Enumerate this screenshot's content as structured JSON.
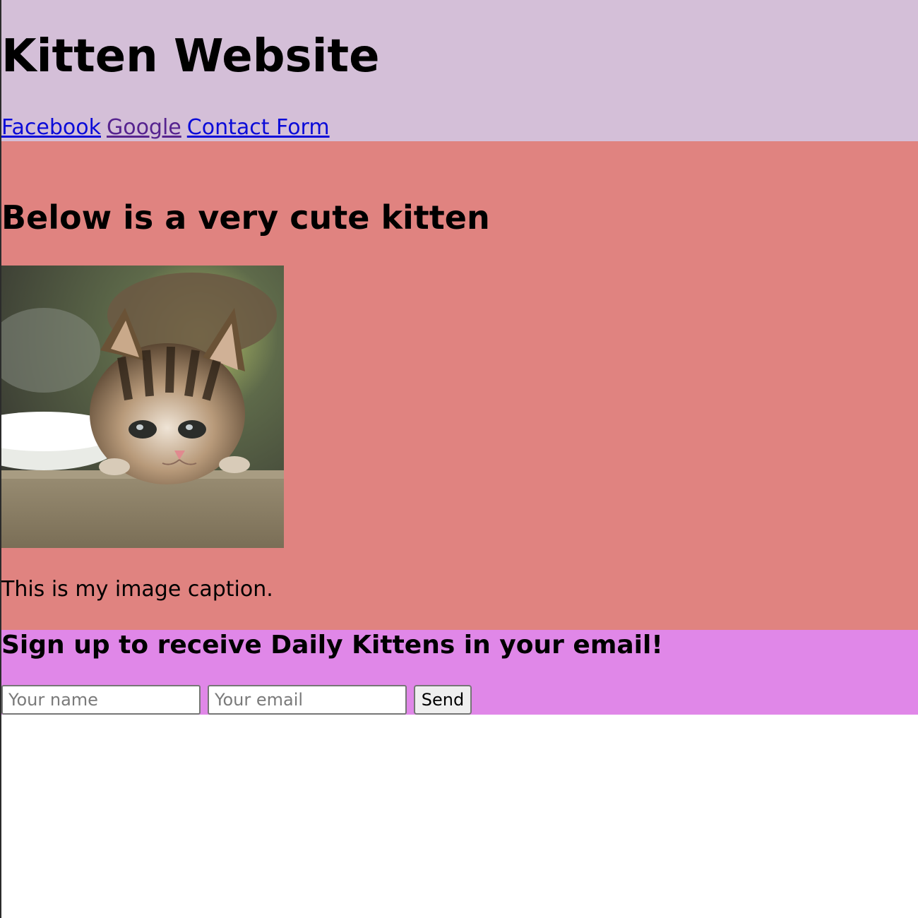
{
  "header": {
    "title": "Kitten Website",
    "nav": [
      {
        "label": "Facebook",
        "state": "link"
      },
      {
        "label": "Google",
        "state": "visited"
      },
      {
        "label": "Contact Form",
        "state": "link"
      }
    ],
    "background": "#d4bfd8"
  },
  "main": {
    "heading": "Below is a very cute kitten",
    "image": {
      "icon": "kitten-photo"
    },
    "caption": "This is my image caption.",
    "background": "#e08380"
  },
  "signup": {
    "heading": "Sign up to receive Daily Kittens in your email!",
    "name_placeholder": "Your name",
    "email_placeholder": "Your email",
    "send_label": "Send",
    "background": "#e087e8"
  },
  "colors": {
    "link": "#0b0bd8",
    "visited": "#56238f"
  }
}
